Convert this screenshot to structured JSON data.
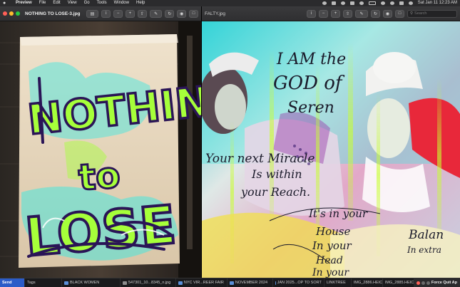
{
  "menubar": {
    "app_name": "Preview",
    "menus": [
      "File",
      "Edit",
      "View",
      "Go",
      "Tools",
      "Window",
      "Help"
    ],
    "datetime": "Sat Jan 11  12:23 AM"
  },
  "left_window": {
    "title": "NOTHING TO LOSE-3.jpg",
    "artwork_text": [
      "NOTHIN",
      "to",
      "LOSE"
    ]
  },
  "right_window": {
    "title": "FALTY.jpg",
    "search_placeholder": "Search",
    "artwork_text": [
      "I AM the",
      "GOD of",
      "Seren",
      "Your next Miracle",
      "Is within",
      "your Reach.",
      "It's in your",
      "House",
      "In your",
      "Head",
      "In your",
      "Balan",
      "In extra"
    ]
  },
  "taskbar": {
    "items": [
      {
        "label": "Send",
        "kind": "send"
      },
      {
        "label": "Tags",
        "kind": "file"
      },
      {
        "label": "BLACK WOMEN",
        "kind": "folder"
      },
      {
        "label": "547301_10...8345_n.jpg",
        "kind": "file"
      },
      {
        "label": "NYC VIR...REER FAIR",
        "kind": "folder"
      },
      {
        "label": "NOVEMBER 2024",
        "kind": "folder"
      },
      {
        "label": "JAN 2025...OP TO SORT",
        "kind": "folder"
      },
      {
        "label": "LINKTREE",
        "kind": "folder"
      },
      {
        "label": "IMG_2886.HEIC",
        "kind": "file"
      },
      {
        "label": "IMG_2885.HEIC",
        "kind": "file"
      }
    ],
    "force_quit": "Force Quit Ap"
  },
  "colors": {
    "cyan": "#3ee8e0",
    "lime": "#a6ff3a",
    "purple": "#3a1a6e",
    "red": "#e8283a"
  }
}
